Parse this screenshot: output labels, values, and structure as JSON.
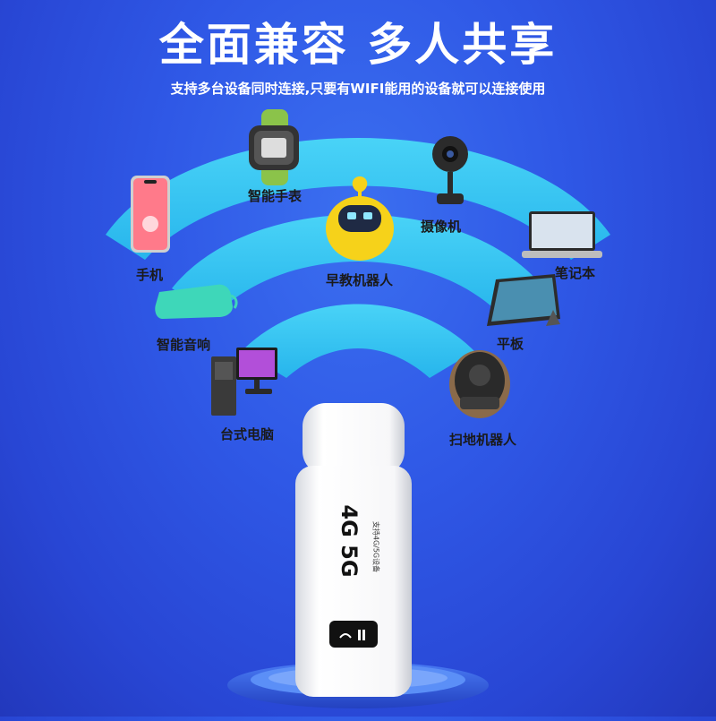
{
  "headline": "全面兼容 多人共享",
  "subheadline": "支持多台设备同时连接,只要有WIFI能用的设备就可以连接使用",
  "devices": {
    "phone": "手机",
    "smartwatch": "智能手表",
    "camera": "摄像机",
    "laptop": "笔记本",
    "robot": "早教机器人",
    "speaker": "智能音响",
    "tablet": "平板",
    "desktop": "台式电脑",
    "vacuum": "扫地机器人"
  },
  "dongle": {
    "brand_text": "4G 5G",
    "small_text": "支持4G/5G设备"
  },
  "colors": {
    "background": "#2f58e6",
    "wave": "#35c6f2",
    "text_main": "#ffffff",
    "label_text": "#1a1a1a"
  }
}
